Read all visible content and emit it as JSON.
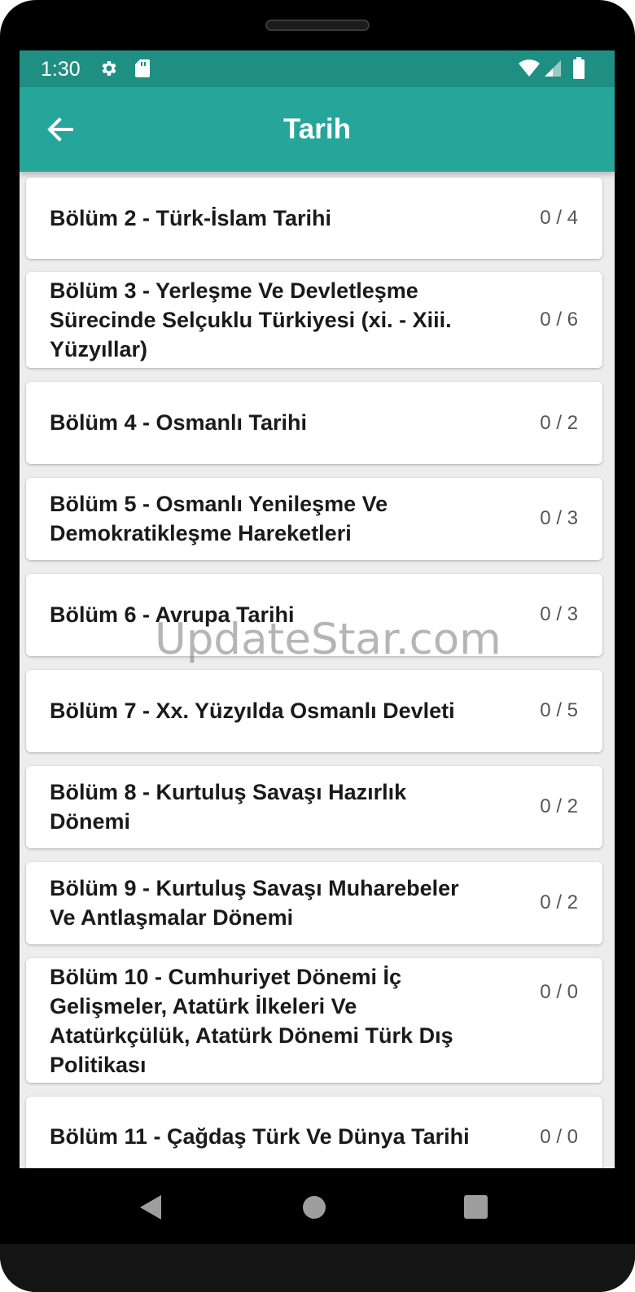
{
  "status_bar": {
    "time": "1:30",
    "icons": [
      "settings-icon",
      "sd-card-icon",
      "wifi-icon",
      "signal-icon",
      "battery-icon"
    ]
  },
  "app_bar": {
    "title": "Tarih",
    "back_icon": "arrow-back-icon",
    "color": "#26a69a"
  },
  "chapters": [
    {
      "title": "Bölüm 2 - Türk-İslam Tarihi",
      "count": "0 / 4"
    },
    {
      "title": "Bölüm 3 - Yerleşme Ve Devletleşme Sürecinde Selçuklu Türkiyesi (xi. - Xiii. Yüzyıllar)",
      "count": "0 / 6"
    },
    {
      "title": "Bölüm 4 - Osmanlı Tarihi",
      "count": "0 / 2"
    },
    {
      "title": "Bölüm 5 - Osmanlı Yenileşme Ve Demokratikleşme Hareketleri",
      "count": "0 / 3"
    },
    {
      "title": "Bölüm 6 - Avrupa Tarihi",
      "count": "0 / 3"
    },
    {
      "title": "Bölüm 7 - Xx. Yüzyılda Osmanlı Devleti",
      "count": "0 / 5"
    },
    {
      "title": "Bölüm 8 - Kurtuluş Savaşı Hazırlık Dönemi",
      "count": "0 / 2"
    },
    {
      "title": "Bölüm 9 - Kurtuluş Savaşı Muharebeler Ve Antlaşmalar Dönemi",
      "count": "0 / 2"
    },
    {
      "title": "Bölüm 10 - Cumhuriyet Dönemi İç Gelişmeler, Atatürk İlkeleri Ve Atatürkçülük, Atatürk Dönemi Türk Dış Politikası",
      "count": "0 / 0"
    },
    {
      "title": "Bölüm 11 - Çağdaş Türk Ve Dünya Tarihi",
      "count": "0 / 0"
    }
  ],
  "watermark": "UpdateStar.com",
  "nav_bar": {
    "icons": [
      "back-triangle-icon",
      "home-circle-icon",
      "recents-square-icon"
    ]
  }
}
